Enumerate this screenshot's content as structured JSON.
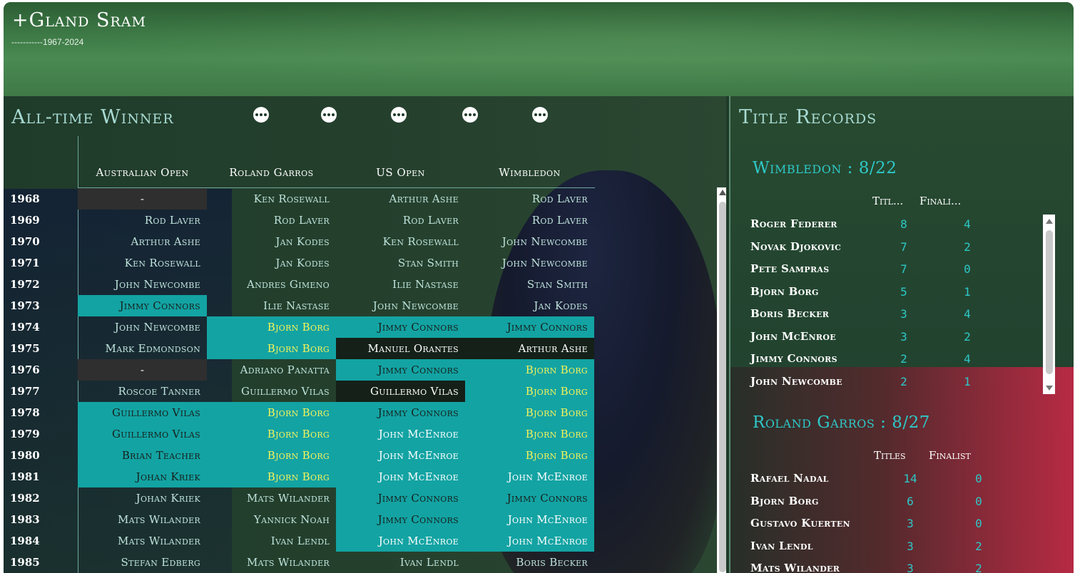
{
  "app": {
    "logo": "+Gland Sram",
    "subtitle": "-----------1967-2024"
  },
  "left_panel": {
    "title": "All-time Winner",
    "columns": [
      "Australian Open",
      "Roland Garros",
      "US Open",
      "Wimbledon"
    ],
    "rows": [
      {
        "year": "1968",
        "cells": [
          "-",
          "Ken Rosewall",
          "Arthur Ashe",
          "Rod Laver"
        ]
      },
      {
        "year": "1969",
        "cells": [
          "Rod Laver",
          "Rod Laver",
          "Rod Laver",
          "Rod Laver"
        ]
      },
      {
        "year": "1970",
        "cells": [
          "Arthur Ashe",
          "Jan Kodes",
          "Ken Rosewall",
          "John Newcombe"
        ]
      },
      {
        "year": "1971",
        "cells": [
          "Ken Rosewall",
          "Jan Kodes",
          "Stan Smith",
          "John Newcombe"
        ]
      },
      {
        "year": "1972",
        "cells": [
          "John Newcombe",
          "Andres Gimeno",
          "Ilie Nastase",
          "Stan Smith"
        ]
      },
      {
        "year": "1973",
        "cells": [
          "Jimmy Connors",
          "Ilie Nastase",
          "John Newcombe",
          "Jan Kodes"
        ]
      },
      {
        "year": "1974",
        "cells": [
          "John Newcombe",
          "Bjorn Borg",
          "Jimmy Connors",
          "Jimmy Connors"
        ]
      },
      {
        "year": "1975",
        "cells": [
          "Mark Edmondson",
          "Bjorn Borg",
          "Manuel Orantes",
          "Arthur Ashe"
        ]
      },
      {
        "year": "1976",
        "cells": [
          "-",
          "Adriano Panatta",
          "Jimmy Connors",
          "Bjorn Borg"
        ]
      },
      {
        "year": "1977",
        "cells": [
          "Roscoe Tanner",
          "Guillermo Vilas",
          "Guillermo Vilas",
          "Bjorn Borg"
        ]
      },
      {
        "year": "1978",
        "cells": [
          "Guillermo Vilas",
          "Bjorn Borg",
          "Jimmy Connors",
          "Bjorn Borg"
        ]
      },
      {
        "year": "1979",
        "cells": [
          "Guillermo Vilas",
          "Bjorn Borg",
          "John McEnroe",
          "Bjorn Borg"
        ]
      },
      {
        "year": "1980",
        "cells": [
          "Brian Teacher",
          "Bjorn Borg",
          "John McEnroe",
          "Bjorn Borg"
        ]
      },
      {
        "year": "1981",
        "cells": [
          "Johan Kriek",
          "Bjorn Borg",
          "John McEnroe",
          "John McEnroe"
        ]
      },
      {
        "year": "1982",
        "cells": [
          "Johan Kriek",
          "Mats Wilander",
          "Jimmy Connors",
          "Jimmy Connors"
        ]
      },
      {
        "year": "1983",
        "cells": [
          "Mats Wilander",
          "Yannick Noah",
          "Jimmy Connors",
          "John McEnroe"
        ]
      },
      {
        "year": "1984",
        "cells": [
          "Mats Wilander",
          "Ivan Lendl",
          "John McEnroe",
          "John McEnroe"
        ]
      },
      {
        "year": "1985",
        "cells": [
          "Stefan Edberg",
          "Mats Wilander",
          "Ivan Lendl",
          "Boris Becker"
        ]
      }
    ]
  },
  "right_panel": {
    "title": "Title Records",
    "wimbledon": {
      "title": "Wimbledon : 8/22",
      "col_titles": "Titl...",
      "col_finalist": "Finali...",
      "rows": [
        {
          "name": "Roger Federer",
          "titles": "8",
          "finalist": "4"
        },
        {
          "name": "Novak Djokovic",
          "titles": "7",
          "finalist": "2"
        },
        {
          "name": "Pete Sampras",
          "titles": "7",
          "finalist": "0"
        },
        {
          "name": "Bjorn Borg",
          "titles": "5",
          "finalist": "1"
        },
        {
          "name": "Boris Becker",
          "titles": "3",
          "finalist": "4"
        },
        {
          "name": "John McEnroe",
          "titles": "3",
          "finalist": "2"
        },
        {
          "name": "Jimmy Connors",
          "titles": "2",
          "finalist": "4"
        },
        {
          "name": "John Newcombe",
          "titles": "2",
          "finalist": "1"
        }
      ]
    },
    "roland_garros": {
      "title": "Roland Garros : 8/27",
      "col_titles": "Titles",
      "col_finalist": "Finalist",
      "rows": [
        {
          "name": "Rafael Nadal",
          "titles": "14",
          "finalist": "0"
        },
        {
          "name": "Bjorn Borg",
          "titles": "6",
          "finalist": "0"
        },
        {
          "name": "Gustavo Kuerten",
          "titles": "3",
          "finalist": "0"
        },
        {
          "name": "Ivan Lendl",
          "titles": "3",
          "finalist": "2"
        },
        {
          "name": "Mats Wilander",
          "titles": "3",
          "finalist": "2"
        }
      ]
    }
  },
  "colors": {
    "accent": "#13a3a3",
    "highlight_text": "#f4f25a",
    "title": "#a9dbd4",
    "record_accent": "#2ec8c8"
  }
}
